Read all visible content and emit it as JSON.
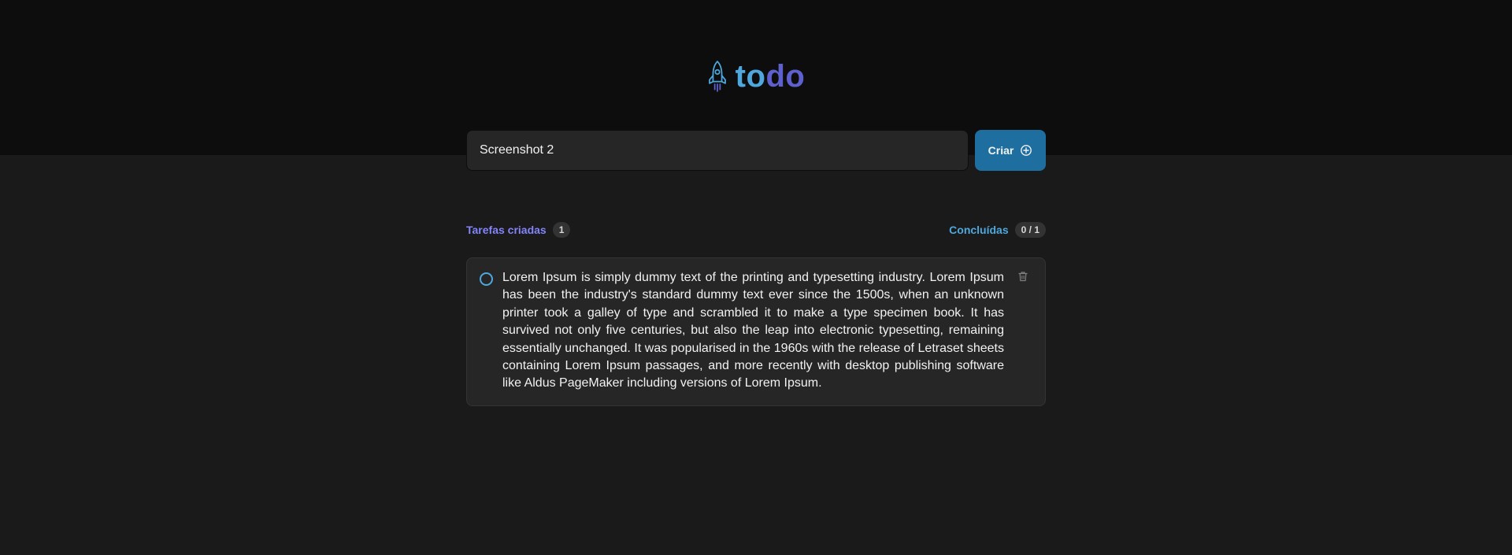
{
  "app": {
    "logo_part_to": "to",
    "logo_part_do": "do"
  },
  "form": {
    "input_value": "Screenshot 2",
    "create_label": "Criar"
  },
  "counters": {
    "created_label": "Tarefas criadas",
    "created_count": "1",
    "done_label": "Concluídas",
    "done_count": "0 / 1"
  },
  "tasks": [
    {
      "text": "Lorem Ipsum is simply dummy text of the printing and typesetting industry. Lorem Ipsum has been the industry's standard dummy text ever since the 1500s, when an unknown printer took a galley of type and scrambled it to make a type specimen book. It has survived not only five centuries, but also the leap into electronic typesetting, remaining essentially unchanged. It was popularised in the 1960s with the release of Letraset sheets containing Lorem Ipsum passages, and more recently with desktop publishing software like Aldus PageMaker including versions of Lorem Ipsum.",
      "completed": false
    }
  ],
  "colors": {
    "blue": "#4ea8de",
    "purple": "#5e60ce",
    "purple_light": "#8284fa",
    "button": "#1e6f9f",
    "header_bg": "#0d0d0d",
    "body_bg": "#1a1a1a"
  },
  "icons": {
    "logo": "rocket-icon",
    "create": "plus-circle-icon",
    "delete": "trash-icon",
    "checkbox": "circle-checkbox-icon"
  }
}
